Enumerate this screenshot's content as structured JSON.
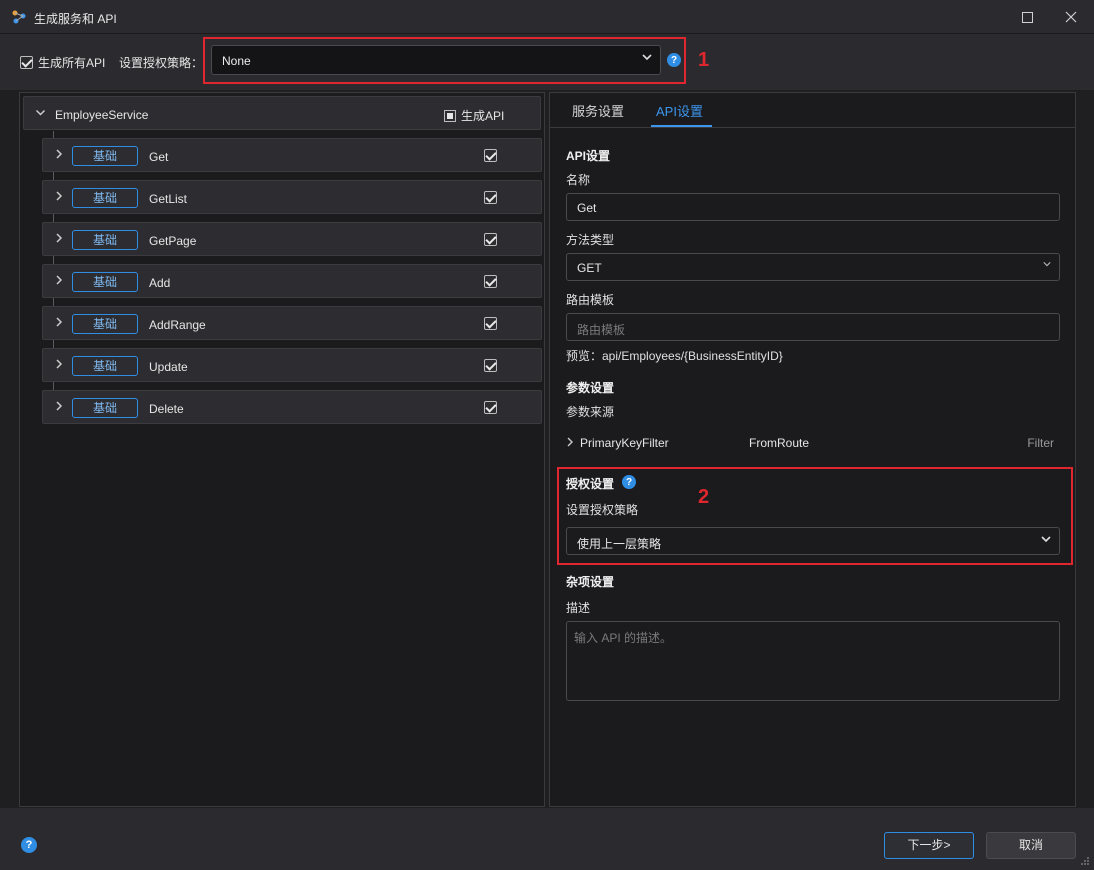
{
  "window": {
    "title": "生成服务和 API",
    "maximize_icon": "maximize-icon",
    "close_icon": "close-icon"
  },
  "toolbar": {
    "generate_all_label": "生成所有API",
    "generate_all_checked": true,
    "auth_policy_label": "设置授权策略：",
    "auth_policy_value": "None",
    "annotation_1": "1"
  },
  "tree": {
    "service_name": "EmployeeService",
    "generate_api_label": "生成API",
    "apis": [
      {
        "tag": "基础",
        "name": "Get",
        "checked": true
      },
      {
        "tag": "基础",
        "name": "GetList",
        "checked": true
      },
      {
        "tag": "基础",
        "name": "GetPage",
        "checked": true
      },
      {
        "tag": "基础",
        "name": "Add",
        "checked": true
      },
      {
        "tag": "基础",
        "name": "AddRange",
        "checked": true
      },
      {
        "tag": "基础",
        "name": "Update",
        "checked": true
      },
      {
        "tag": "基础",
        "name": "Delete",
        "checked": true
      }
    ]
  },
  "panel": {
    "tabs": [
      "服务设置",
      "API设置"
    ],
    "active_tab": "API设置",
    "api_settings_title": "API设置",
    "name_label": "名称",
    "name_value": "Get",
    "method_label": "方法类型",
    "method_value": "GET",
    "route_label": "路由模板",
    "route_placeholder": "路由模板",
    "preview_text": "预览：api/Employees/{BusinessEntityID}",
    "param_title": "参数设置",
    "param_source_label": "参数来源",
    "param_name": "PrimaryKeyFilter",
    "param_source": "FromRoute",
    "param_kind": "Filter",
    "auth_title": "授权设置",
    "auth_policy_label": "设置授权策略",
    "auth_policy_value": "使用上一层策略",
    "annotation_2": "2",
    "misc_title": "杂项设置",
    "desc_label": "描述",
    "desc_placeholder": "输入 API 的描述。"
  },
  "footer": {
    "next_label": "下一步>",
    "cancel_label": "取消"
  }
}
